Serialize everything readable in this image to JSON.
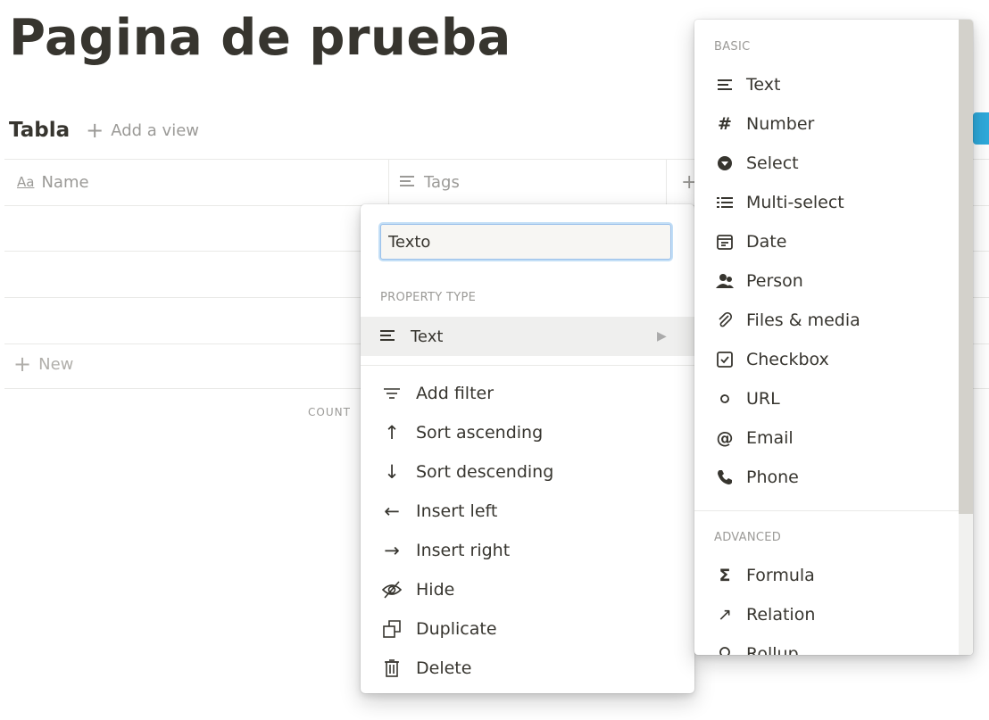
{
  "page": {
    "title": "Pagina de prueba"
  },
  "view": {
    "name": "Tabla",
    "add_view_label": "Add a view"
  },
  "table": {
    "columns": [
      {
        "icon": "text-aa-icon",
        "label": "Name"
      },
      {
        "icon": "text-lines-icon",
        "label": "Tags"
      }
    ],
    "new_label": "New",
    "count_label": "COUNT"
  },
  "property_menu": {
    "name_value": "Texto",
    "property_type_label": "PROPERTY TYPE",
    "current_type": {
      "icon": "text-lines-icon",
      "label": "Text"
    },
    "actions": [
      {
        "icon": "filter-icon",
        "label": "Add filter"
      },
      {
        "icon": "arrow-up-icon",
        "label": "Sort ascending"
      },
      {
        "icon": "arrow-down-icon",
        "label": "Sort descending"
      },
      {
        "icon": "arrow-left-icon",
        "label": "Insert left"
      },
      {
        "icon": "arrow-right-icon",
        "label": "Insert right"
      },
      {
        "icon": "eye-slash-icon",
        "label": "Hide"
      },
      {
        "icon": "duplicate-icon",
        "label": "Duplicate"
      },
      {
        "icon": "trash-icon",
        "label": "Delete"
      }
    ]
  },
  "type_submenu": {
    "basic_label": "BASIC",
    "basic": [
      {
        "icon": "text-lines-icon",
        "label": "Text"
      },
      {
        "icon": "hash-icon",
        "label": "Number"
      },
      {
        "icon": "select-icon",
        "label": "Select"
      },
      {
        "icon": "list-icon",
        "label": "Multi-select"
      },
      {
        "icon": "calendar-icon",
        "label": "Date"
      },
      {
        "icon": "person-icon",
        "label": "Person"
      },
      {
        "icon": "paperclip-icon",
        "label": "Files & media"
      },
      {
        "icon": "checkbox-icon",
        "label": "Checkbox"
      },
      {
        "icon": "link-icon",
        "label": "URL"
      },
      {
        "icon": "at-icon",
        "label": "Email"
      },
      {
        "icon": "phone-icon",
        "label": "Phone"
      }
    ],
    "advanced_label": "ADVANCED",
    "advanced": [
      {
        "icon": "sigma-icon",
        "label": "Formula"
      },
      {
        "icon": "arrow-up-right-icon",
        "label": "Relation"
      },
      {
        "icon": "search-icon",
        "label": "Rollup"
      }
    ]
  },
  "colors": {
    "accent": "#2eaadc",
    "text": "#37352f",
    "muted": "#9b9a97",
    "hover": "#efefee"
  }
}
